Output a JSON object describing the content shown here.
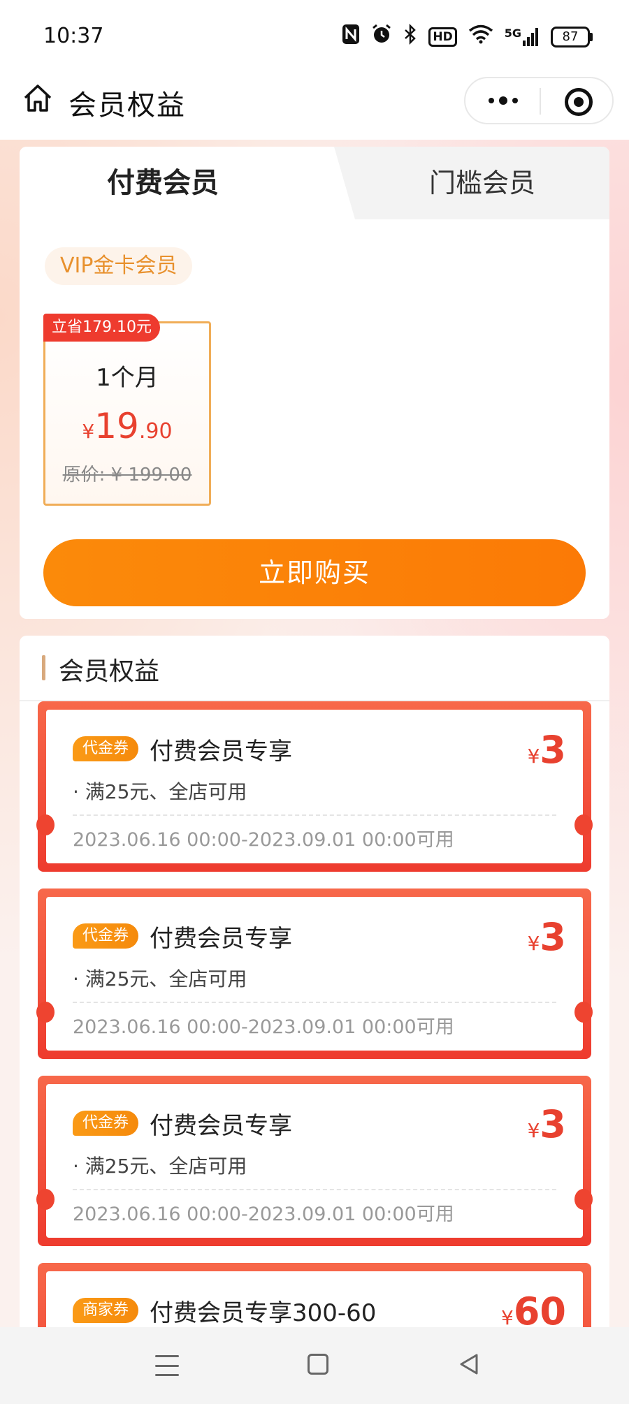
{
  "status_bar": {
    "time": "10:37",
    "icons": [
      "nfc-icon",
      "alarm-icon",
      "bluetooth-icon",
      "hd-icon",
      "wifi-icon",
      "signal-5g-icon"
    ],
    "hd_label": "HD",
    "network_label": "5G",
    "battery": "87"
  },
  "header": {
    "title": "会员权益"
  },
  "tabs": {
    "paid": "付费会员",
    "threshold": "门槛会员"
  },
  "membership": {
    "tier_tag": "VIP金卡会员",
    "plan": {
      "save_badge": "立省179.10元",
      "period": "1个月",
      "currency": "¥",
      "price_int": "19",
      "price_dec": ".90",
      "original": "原价: ¥ 199.00"
    },
    "buy_label": "立即购买"
  },
  "benefits": {
    "title": "会员权益",
    "coupons": [
      {
        "tag": "代金券",
        "title": "付费会员专享",
        "currency": "¥",
        "amount": "3",
        "condition": "· 满25元、全店可用",
        "validity": "2023.06.16 00:00-2023.09.01 00:00可用"
      },
      {
        "tag": "代金券",
        "title": "付费会员专享",
        "currency": "¥",
        "amount": "3",
        "condition": "· 满25元、全店可用",
        "validity": "2023.06.16 00:00-2023.09.01 00:00可用"
      },
      {
        "tag": "代金券",
        "title": "付费会员专享",
        "currency": "¥",
        "amount": "3",
        "condition": "· 满25元、全店可用",
        "validity": "2023.06.16 00:00-2023.09.01 00:00可用"
      },
      {
        "tag": "商家券",
        "title": "付费会员专享300-60",
        "currency": "¥",
        "amount": "60",
        "condition": "",
        "validity": ""
      }
    ]
  },
  "colors": {
    "accent_orange": "#fb8a0a",
    "coupon_red": "#ee3b2e",
    "price_red": "#e8412f",
    "gold": "#e8912e"
  }
}
